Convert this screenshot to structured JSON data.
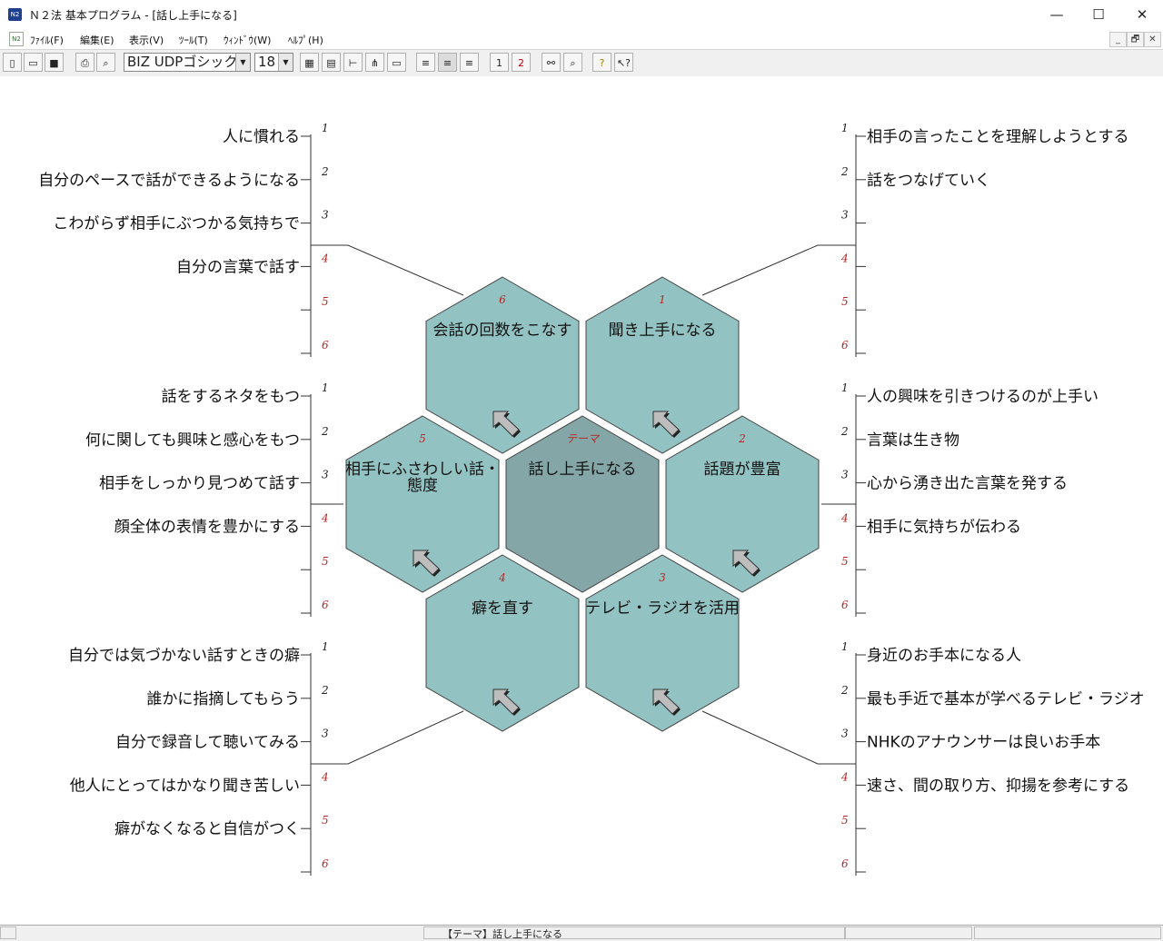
{
  "window": {
    "title": "Ｎ２法 基本プログラム - [話し上手になる]",
    "app_icon": "N2",
    "minimize": "—",
    "maximize": "☐",
    "close": "✕"
  },
  "menubar": {
    "icon": "N2",
    "items": [
      "ﾌｧｲﾙ(F)",
      "編集(E)",
      "表示(V)",
      "ﾂｰﾙ(T)",
      "ｳｨﾝﾄﾞｳ(W)",
      "ﾍﾙﾌﾟ(H)"
    ],
    "mdi_buttons": [
      "_",
      "🗗",
      "✕"
    ]
  },
  "toolbar": {
    "font_name": "BIZ UDPゴシック",
    "font_size": "18"
  },
  "theme": {
    "number": "テーマ",
    "label": "話し上手になる"
  },
  "hexagons": [
    {
      "number": "1",
      "label": "聞き上手になる"
    },
    {
      "number": "2",
      "label": "話題が豊富"
    },
    {
      "number": "3",
      "label": "テレビ・ラジオを活用"
    },
    {
      "number": "4",
      "label": "癖を直す"
    },
    {
      "number": "5",
      "label": "相手にふさわしい話・\n態度"
    },
    {
      "number": "6",
      "label": "会話の回数をこなす"
    }
  ],
  "branches": {
    "top_left": {
      "numbers": [
        "1",
        "2",
        "3",
        "4",
        "5",
        "6"
      ],
      "items": [
        "人に慣れる",
        "自分のペースで話ができるようになる",
        "こわがらず相手にぶつかる気持ちで",
        "自分の言葉で話す",
        "",
        ""
      ]
    },
    "middle_left": {
      "numbers": [
        "1",
        "2",
        "3",
        "4",
        "5",
        "6"
      ],
      "items": [
        "話をするネタをもつ",
        "何に関しても興味と感心をもつ",
        "相手をしっかり見つめて話す",
        "顔全体の表情を豊かにする",
        "",
        ""
      ]
    },
    "bottom_left": {
      "numbers": [
        "1",
        "2",
        "3",
        "4",
        "5",
        "6"
      ],
      "items": [
        "自分では気づかない話すときの癖",
        "誰かに指摘してもらう",
        "自分で録音して聴いてみる",
        "他人にとってはかなり聞き苦しい",
        "癖がなくなると自信がつく",
        ""
      ]
    },
    "top_right": {
      "numbers": [
        "1",
        "2",
        "3",
        "4",
        "5",
        "6"
      ],
      "items": [
        "相手の言ったことを理解しようとする",
        "話をつなげていく",
        "",
        "",
        "",
        ""
      ]
    },
    "middle_right": {
      "numbers": [
        "1",
        "2",
        "3",
        "4",
        "5",
        "6"
      ],
      "items": [
        "人の興味を引きつけるのが上手い",
        "言葉は生き物",
        "心から湧き出た言葉を発する",
        "相手に気持ちが伝わる",
        "",
        ""
      ]
    },
    "bottom_right": {
      "numbers": [
        "1",
        "2",
        "3",
        "4",
        "5",
        "6"
      ],
      "items": [
        "身近のお手本になる人",
        "最も手近で基本が学べるテレビ・ラジオ",
        "NHKのアナウンサーは良いお手本",
        "速さ、間の取り方、抑揚を参考にする",
        "",
        ""
      ]
    }
  },
  "colors": {
    "hex_fill": "#93c2c2",
    "theme_fill": "#84a6a6",
    "number_red": "#b42828"
  },
  "statusbar": {
    "text": "【テーマ】話し上手になる"
  }
}
